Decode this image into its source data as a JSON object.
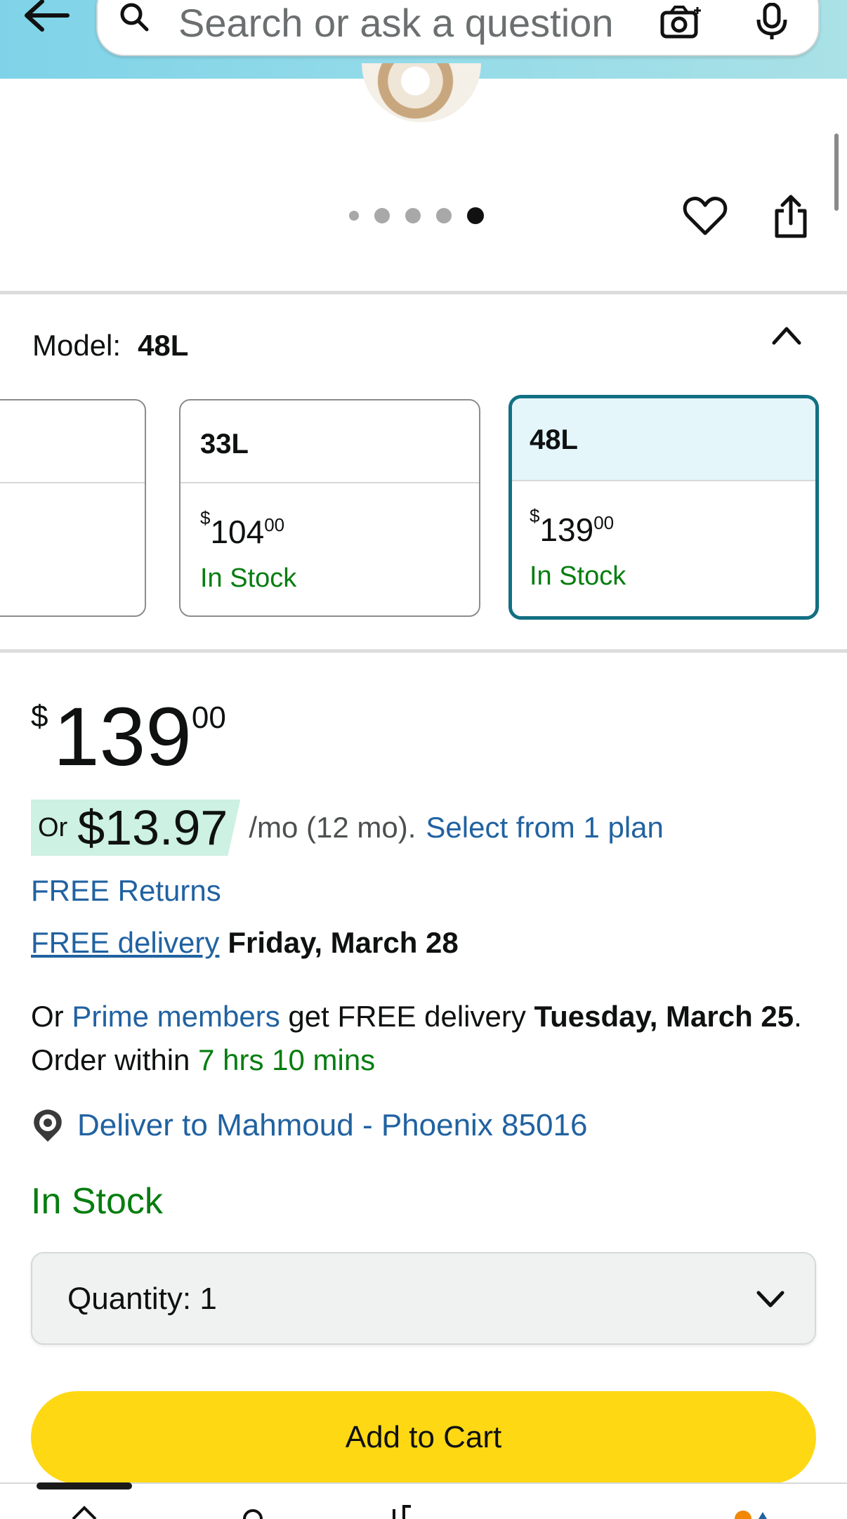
{
  "header": {
    "search_placeholder": "Search or ask a question",
    "back_icon": "arrow-left-icon",
    "camera_icon": "camera-icon",
    "mic_icon": "microphone-icon"
  },
  "gallery": {
    "image_count": 5,
    "active_index": 4
  },
  "model": {
    "label": "Model:",
    "selected": "48L",
    "variants": [
      {
        "name": "33L",
        "price_whole": "104",
        "price_cents": "00",
        "currency": "$",
        "stock": "In Stock"
      },
      {
        "name": "48L",
        "price_whole": "139",
        "price_cents": "00",
        "currency": "$",
        "stock": "In Stock"
      }
    ]
  },
  "price": {
    "currency": "$",
    "whole": "139",
    "cents": "00"
  },
  "installment": {
    "prefix": "Or",
    "amount": "$13.97",
    "terms": "/mo (12 mo).",
    "link": "Select from 1 plan"
  },
  "returns": "FREE Returns",
  "delivery": {
    "link": "FREE delivery",
    "date": "Friday, March 28"
  },
  "prime": {
    "prefix": "Or",
    "link": "Prime members",
    "middle": "get FREE delivery",
    "date_part1": "Tuesday, March",
    "date_part2": "25",
    "order_text": ". Order within",
    "countdown": "7 hrs 10 mins"
  },
  "deliver_to": "Deliver to Mahmoud - Phoenix 85016",
  "stock_status": "In Stock",
  "quantity": {
    "label": "Quantity:",
    "value": "1"
  },
  "add_to_cart": "Add to Cart",
  "colors": {
    "accent_teal": "#127083",
    "link_blue": "#2162a1",
    "stock_green": "#067d10",
    "cart_yellow": "#ffd814"
  }
}
